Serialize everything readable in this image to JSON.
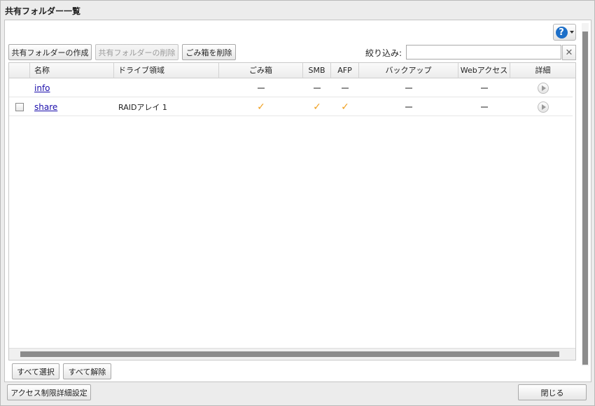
{
  "dialog": {
    "title": "共有フォルダー一覧"
  },
  "toolbar": {
    "create_label": "共有フォルダーの作成",
    "delete_label": "共有フォルダーの削除",
    "empty_trash_label": "ごみ箱を削除",
    "filter_label": "絞り込み:",
    "filter_value": "",
    "clear_glyph": "✕",
    "help_glyph": "?"
  },
  "table": {
    "columns": [
      "名称",
      "ドライブ領域",
      "ごみ箱",
      "SMB",
      "AFP",
      "バックアップ",
      "Webアクセス",
      "詳細"
    ],
    "rows": [
      {
        "name": "info",
        "drive": "",
        "checkbox": false,
        "trash": "none",
        "smb": "none",
        "afp": "none",
        "backup": "none",
        "web": "none"
      },
      {
        "name": "share",
        "drive": "RAIDアレイ 1",
        "checkbox": true,
        "trash": "enabled",
        "smb": "enabled",
        "afp": "enabled",
        "backup": "none",
        "web": "none"
      }
    ],
    "check_glyph": "✓"
  },
  "selection": {
    "select_all_label": "すべて選択",
    "deselect_all_label": "すべて解除"
  },
  "footer": {
    "access_settings_label": "アクセス制限詳細設定",
    "close_label": "閉じる"
  },
  "colors": {
    "accent": "#1d6fc8",
    "check": "#f0a020",
    "link": "#1a0dab"
  }
}
